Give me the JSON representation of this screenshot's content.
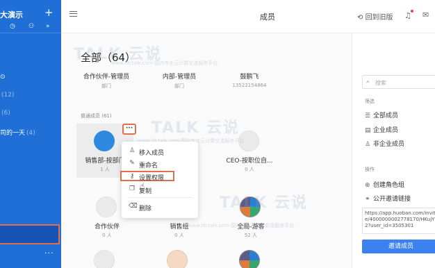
{
  "sidebar": {
    "title": "大演示",
    "plus": "+",
    "icons": [
      "clock-icon",
      "org-icon",
      "expand-icon"
    ],
    "items": [
      {
        "label": "",
        "count": ""
      },
      {
        "label": "",
        "count": "(12)"
      },
      {
        "label": "",
        "count": "(6)"
      },
      {
        "label": "司的一天",
        "count": "(4)"
      }
    ],
    "more": "···"
  },
  "topbar": {
    "title": "成员",
    "back_old": "回到旧版"
  },
  "main": {
    "section_title": "全部（64）",
    "admins": [
      {
        "name": "合作伙伴-管理员",
        "sub": "部门"
      },
      {
        "name": "内部-管理员",
        "sub": "部门"
      },
      {
        "name": "鼓鹏飞",
        "sub": "13522154864"
      }
    ],
    "normal_label": "普通成员 (61)",
    "cards": [
      {
        "name": "销售部-按部门",
        "sub": "1 人"
      },
      {
        "name": "",
        "sub": ""
      },
      {
        "name": "CEO-按职位自...",
        "sub": "0 人"
      },
      {
        "name": "合作伙伴",
        "sub": "0 人"
      },
      {
        "name": "销售组",
        "sub": "0 人"
      },
      {
        "name": "全局-游客",
        "sub": "52 人"
      }
    ],
    "more_button": "···",
    "menu": [
      {
        "icon": "add-user-icon",
        "glyph": "♙",
        "label": "移入成员"
      },
      {
        "icon": "edit-icon",
        "glyph": "✎",
        "label": "重命名"
      },
      {
        "icon": "key-icon",
        "glyph": "⚷",
        "label": "设置权限"
      },
      {
        "icon": "copy-icon",
        "glyph": "❐",
        "label": "复制"
      },
      {
        "icon": "trash-icon",
        "glyph": "🗑",
        "label": "删除"
      }
    ]
  },
  "right_panel": {
    "search_placeholder": "搜索",
    "filter_label": "筛选",
    "filters": [
      {
        "icon": "list-icon",
        "glyph": "☰",
        "label": "全部成员"
      },
      {
        "icon": "building-icon",
        "glyph": "▤",
        "label": "企业成员"
      },
      {
        "icon": "user-icon",
        "glyph": "♙",
        "label": "非企业成员"
      }
    ],
    "ops_label": "操作",
    "ops": [
      {
        "icon": "plus-circle-icon",
        "glyph": "⊕",
        "label": "创建角色组"
      },
      {
        "icon": "link-icon",
        "glyph": "⚭",
        "label": "公开邀请链接"
      }
    ],
    "invite_url": "https://app.huoban.com/invite/4000000002778170/HKujY2?user_id=3505301",
    "invite_button": "邀请成员"
  },
  "watermark": {
    "brand": "TALK 云说",
    "sub": "-www.idctalk.com-国内专业云计算交流服务平台-"
  }
}
